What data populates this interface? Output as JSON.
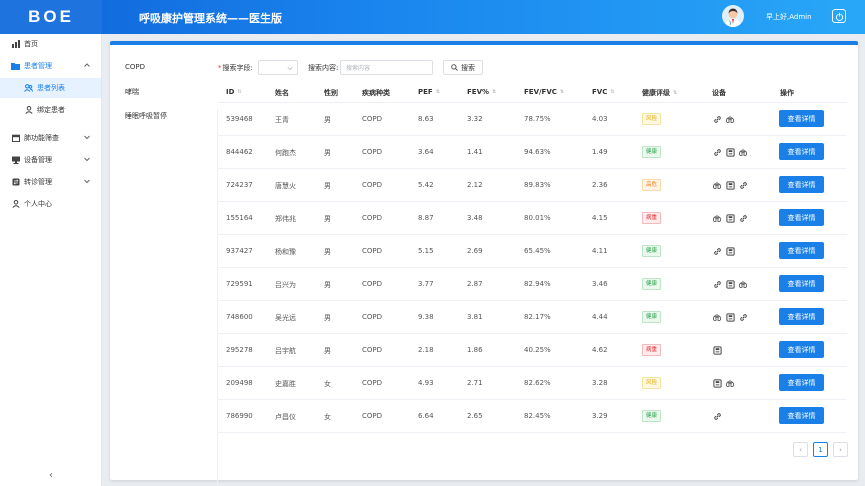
{
  "header": {
    "logo": "BOE",
    "app_title": "呼吸康护管理系统——医生版",
    "greeting": "早上好,Admin"
  },
  "sidebar": {
    "items": [
      {
        "label": "首页",
        "icon": "bar-chart-icon"
      },
      {
        "label": "患者管理",
        "icon": "folder-icon",
        "expanded": true
      },
      {
        "label": "患者列表",
        "icon": "users-icon",
        "active": true
      },
      {
        "label": "绑定患者",
        "icon": "user-icon"
      },
      {
        "label": "肺功能筛查",
        "icon": "calendar-icon"
      },
      {
        "label": "设备管理",
        "icon": "monitor-icon"
      },
      {
        "label": "转诊管理",
        "icon": "transfer-icon"
      },
      {
        "label": "个人中心",
        "icon": "user-icon"
      }
    ],
    "collapse": "‹"
  },
  "categories": [
    "COPD",
    "哮喘",
    "睡眠呼吸暂停"
  ],
  "search": {
    "field_label": "搜索字段:",
    "content_label": "搜索内容:",
    "placeholder": "搜索内容",
    "button": "搜索"
  },
  "table": {
    "columns": [
      "ID",
      "姓名",
      "性别",
      "疾病种类",
      "PEF",
      "FEV%",
      "FEV/FVC",
      "FVC",
      "健康评级",
      "设备",
      "操作"
    ],
    "action_label": "查看详情",
    "rows": [
      {
        "id": "539468",
        "name": "王青",
        "gender": "男",
        "disease": "COPD",
        "pef": "8.63",
        "fev": "3.32",
        "ratio": "78.75%",
        "fvc": "4.03",
        "rating": "风险",
        "rating_color": "yellow",
        "devices": [
          "link",
          "lung"
        ]
      },
      {
        "id": "844462",
        "name": "何跑杰",
        "gender": "男",
        "disease": "COPD",
        "pef": "3.64",
        "fev": "1.41",
        "ratio": "94.63%",
        "fvc": "1.49",
        "rating": "健康",
        "rating_color": "green",
        "devices": [
          "link",
          "meter",
          "lung"
        ]
      },
      {
        "id": "724237",
        "name": "唐慧火",
        "gender": "男",
        "disease": "COPD",
        "pef": "5.42",
        "fev": "2.12",
        "ratio": "89.83%",
        "fvc": "2.36",
        "rating": "高危",
        "rating_color": "orange",
        "devices": [
          "lung",
          "meter",
          "link"
        ]
      },
      {
        "id": "155164",
        "name": "郑伟兆",
        "gender": "男",
        "disease": "COPD",
        "pef": "8.87",
        "fev": "3.48",
        "ratio": "80.01%",
        "fvc": "4.15",
        "rating": "病重",
        "rating_color": "red",
        "devices": [
          "lung",
          "meter",
          "link"
        ]
      },
      {
        "id": "937427",
        "name": "杨和豫",
        "gender": "男",
        "disease": "COPD",
        "pef": "5.15",
        "fev": "2.69",
        "ratio": "65.45%",
        "fvc": "4.11",
        "rating": "健康",
        "rating_color": "green",
        "devices": [
          "link",
          "meter"
        ]
      },
      {
        "id": "729591",
        "name": "吕兴为",
        "gender": "男",
        "disease": "COPD",
        "pef": "3.77",
        "fev": "2.87",
        "ratio": "82.94%",
        "fvc": "3.46",
        "rating": "健康",
        "rating_color": "green",
        "devices": [
          "link",
          "meter",
          "lung"
        ]
      },
      {
        "id": "748600",
        "name": "吴光远",
        "gender": "男",
        "disease": "COPD",
        "pef": "9.38",
        "fev": "3.81",
        "ratio": "82.17%",
        "fvc": "4.44",
        "rating": "健康",
        "rating_color": "green",
        "devices": [
          "lung",
          "meter",
          "link"
        ]
      },
      {
        "id": "295278",
        "name": "吕宇航",
        "gender": "男",
        "disease": "COPD",
        "pef": "2.18",
        "fev": "1.86",
        "ratio": "40.25%",
        "fvc": "4.62",
        "rating": "病重",
        "rating_color": "red",
        "devices": [
          "meter"
        ]
      },
      {
        "id": "209498",
        "name": "史嘉胜",
        "gender": "女",
        "disease": "COPD",
        "pef": "4.93",
        "fev": "2.71",
        "ratio": "82.62%",
        "fvc": "3.28",
        "rating": "风险",
        "rating_color": "yellow",
        "devices": [
          "meter",
          "lung"
        ]
      },
      {
        "id": "786990",
        "name": "卢昌仪",
        "gender": "女",
        "disease": "COPD",
        "pef": "6.64",
        "fev": "2.65",
        "ratio": "82.45%",
        "fvc": "3.29",
        "rating": "健康",
        "rating_color": "green",
        "devices": [
          "link"
        ]
      }
    ]
  },
  "pagination": {
    "prev": "‹",
    "current": "1",
    "next": "›"
  }
}
